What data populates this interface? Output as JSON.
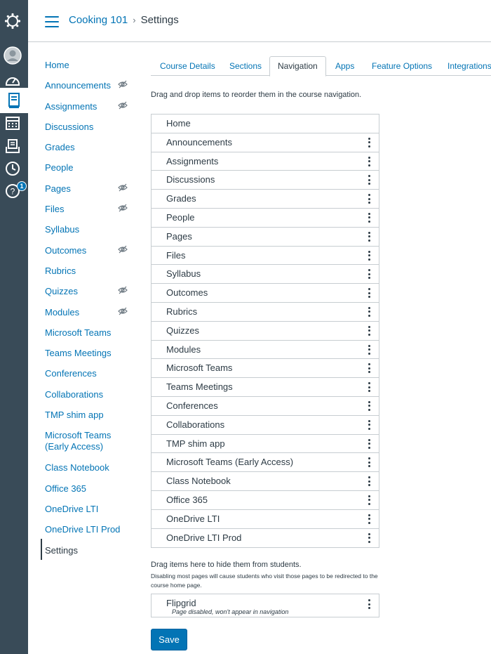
{
  "header": {
    "course_link": "Cooking 101",
    "separator": "›",
    "current": "Settings"
  },
  "global_nav": {
    "icons": [
      "canvas-logo-icon",
      "account-icon",
      "dashboard-icon",
      "courses-icon",
      "calendar-icon",
      "inbox-icon",
      "history-icon",
      "help-icon"
    ],
    "help_badge": "1"
  },
  "course_nav": [
    {
      "label": "Home",
      "hidden": false
    },
    {
      "label": "Announcements",
      "hidden": true
    },
    {
      "label": "Assignments",
      "hidden": true
    },
    {
      "label": "Discussions",
      "hidden": false
    },
    {
      "label": "Grades",
      "hidden": false
    },
    {
      "label": "People",
      "hidden": false
    },
    {
      "label": "Pages",
      "hidden": true
    },
    {
      "label": "Files",
      "hidden": true
    },
    {
      "label": "Syllabus",
      "hidden": false
    },
    {
      "label": "Outcomes",
      "hidden": true
    },
    {
      "label": "Rubrics",
      "hidden": false
    },
    {
      "label": "Quizzes",
      "hidden": true
    },
    {
      "label": "Modules",
      "hidden": true
    },
    {
      "label": "Microsoft Teams",
      "hidden": false
    },
    {
      "label": "Teams Meetings",
      "hidden": false
    },
    {
      "label": "Conferences",
      "hidden": false
    },
    {
      "label": "Collaborations",
      "hidden": false
    },
    {
      "label": "TMP shim app",
      "hidden": false
    },
    {
      "label": "Microsoft Teams (Early Access)",
      "hidden": false
    },
    {
      "label": "Class Notebook",
      "hidden": false
    },
    {
      "label": "Office 365",
      "hidden": false
    },
    {
      "label": "OneDrive LTI",
      "hidden": false
    },
    {
      "label": "OneDrive LTI Prod",
      "hidden": false
    },
    {
      "label": "Settings",
      "hidden": false,
      "current": true
    }
  ],
  "tabs": [
    {
      "label": "Course Details",
      "active": false
    },
    {
      "label": "Sections",
      "active": false
    },
    {
      "label": "Navigation",
      "active": true
    },
    {
      "label": "Apps",
      "active": false
    },
    {
      "label": "Feature Options",
      "active": false
    },
    {
      "label": "Integrations",
      "active": false
    }
  ],
  "navigation": {
    "instructions": "Drag and drop items to reorder them in the course navigation.",
    "enabled_items": [
      "Home",
      "Announcements",
      "Assignments",
      "Discussions",
      "Grades",
      "People",
      "Pages",
      "Files",
      "Syllabus",
      "Outcomes",
      "Rubrics",
      "Quizzes",
      "Modules",
      "Microsoft Teams",
      "Teams Meetings",
      "Conferences",
      "Collaborations",
      "TMP shim app",
      "Microsoft Teams (Early Access)",
      "Class Notebook",
      "Office 365",
      "OneDrive LTI",
      "OneDrive LTI Prod"
    ],
    "hide_label": "Drag items here to hide them from students.",
    "hide_note": "Disabling most pages will cause students who visit those pages to be redirected to the course home page.",
    "disabled_items": [
      {
        "label": "Flipgrid",
        "note": "Page disabled, won't appear in navigation"
      }
    ],
    "save_label": "Save"
  },
  "colors": {
    "link": "#0374b5",
    "rail": "#394b58",
    "text": "#2d3b45",
    "border": "#c7cdd1"
  }
}
